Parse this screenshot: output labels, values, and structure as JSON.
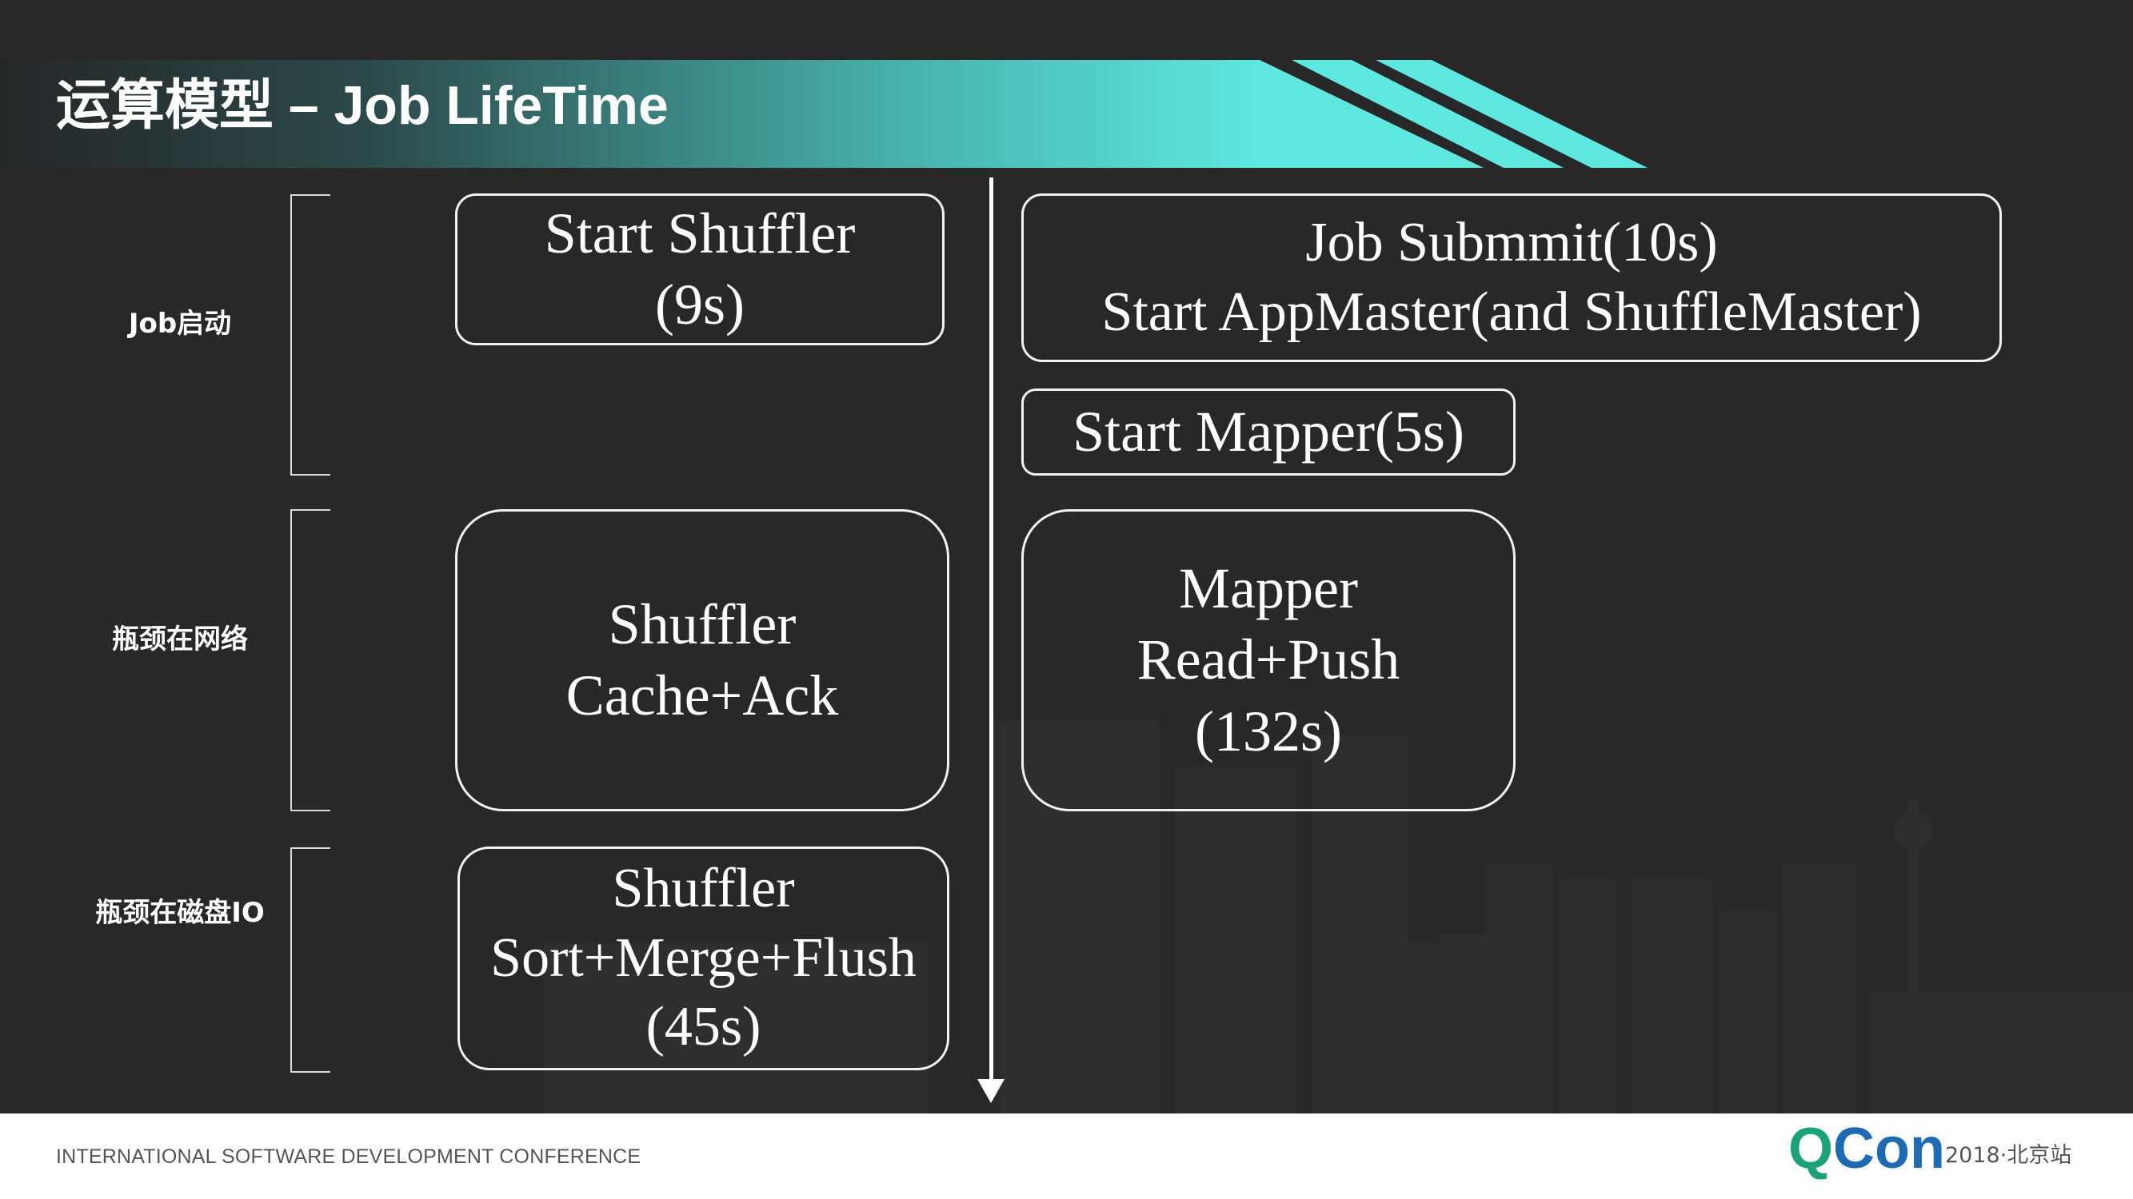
{
  "title": "运算模型 – Job LifeTime",
  "phases": [
    {
      "label": "Job启动"
    },
    {
      "label": "瓶颈在网络"
    },
    {
      "label": "瓶颈在磁盘IO"
    }
  ],
  "shuffler_boxes": [
    {
      "lines": [
        "Start Shuffler",
        "(9s)"
      ]
    },
    {
      "lines": [
        "Shuffler",
        "Cache+Ack"
      ]
    },
    {
      "lines": [
        "Shuffler",
        "Sort+Merge+Flush",
        "(45s)"
      ]
    }
  ],
  "mapper_boxes": [
    {
      "lines": [
        "Job Submmit(10s)",
        "Start AppMaster(and ShuffleMaster)"
      ]
    },
    {
      "lines": [
        "Start Mapper(5s)"
      ]
    },
    {
      "lines": [
        "Mapper",
        "Read+Push",
        "(132s)"
      ]
    }
  ],
  "footer": {
    "conference": "INTERNATIONAL SOFTWARE DEVELOPMENT CONFERENCE",
    "logo_q": "Q",
    "logo_con": "Con",
    "edition": "2018·北京站"
  },
  "colors": {
    "background": "#282828",
    "banner_start": "#2c4a4a",
    "banner_end": "#5ee8e0",
    "logo_green": "#1aa37a",
    "logo_blue": "#1d6bb5"
  }
}
